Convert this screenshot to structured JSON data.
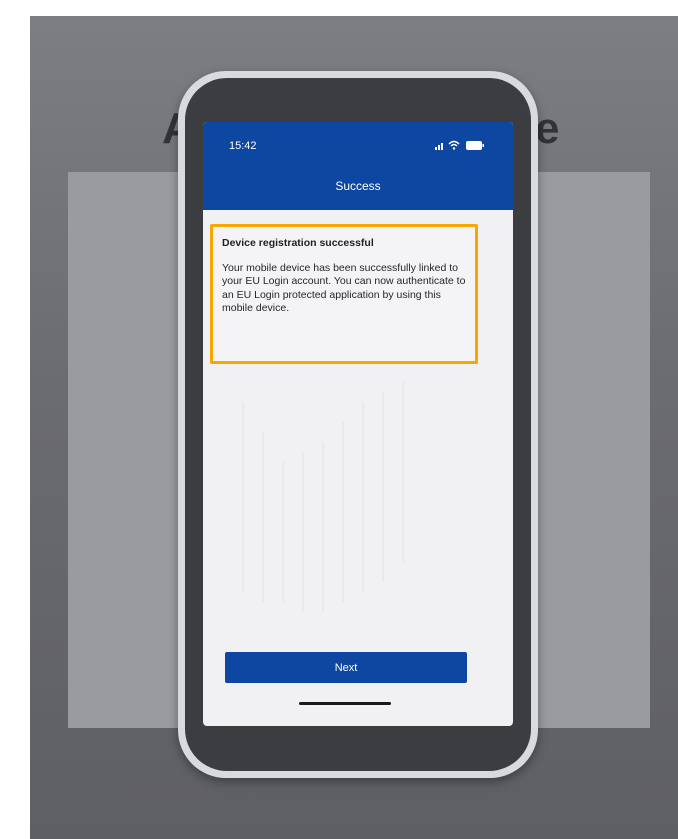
{
  "background": {
    "title_left": "A",
    "title_right": "e"
  },
  "phone": {
    "status_bar": {
      "time": "15:42",
      "icons": [
        "signal-icon",
        "wifi-icon",
        "battery-icon"
      ]
    },
    "nav": {
      "title": "Success"
    },
    "message": {
      "heading": "Device registration successful",
      "body": "Your mobile device has been successfully linked to your EU Login account. You can now authenticate to an EU Login protected application by using this mobile device."
    },
    "next_label": "Next"
  },
  "colors": {
    "brand_blue": "#0e47a1",
    "highlight": "#f6a800"
  }
}
